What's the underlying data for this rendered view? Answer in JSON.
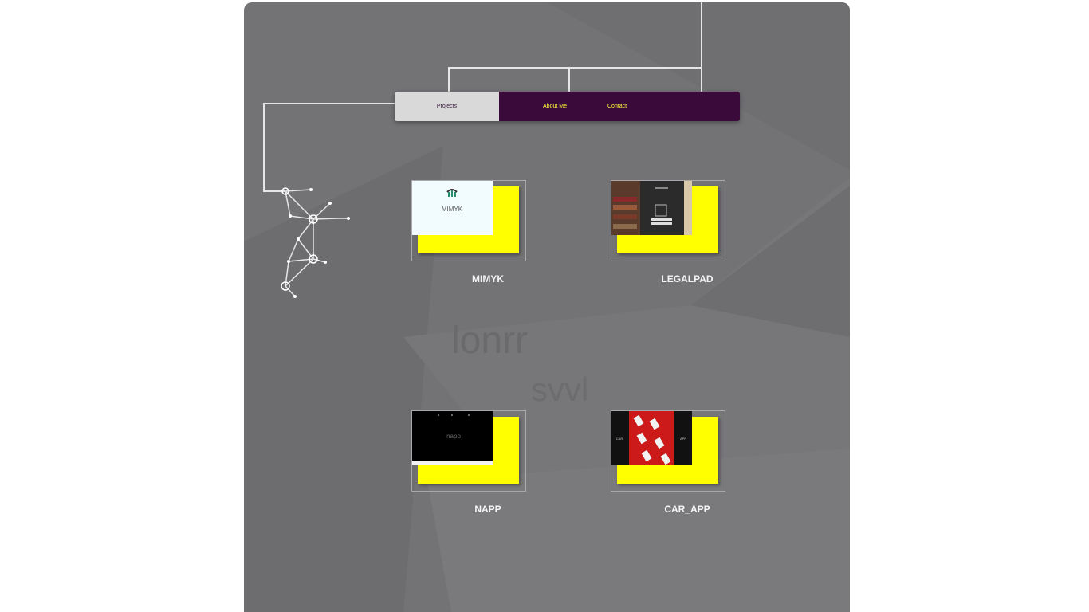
{
  "nav": {
    "projects_label": "Projects",
    "about_label": "About Me",
    "contact_label": "Contact"
  },
  "projects": [
    {
      "title": "MIMYK",
      "thumb_text": "MIMYK"
    },
    {
      "title": "LEGALPAD"
    },
    {
      "title": "NAPP",
      "thumb_text": "napp"
    },
    {
      "title": "CAR_APP",
      "thumb_left_text": "CAR",
      "thumb_right_text": "APP"
    }
  ],
  "colors": {
    "panel_bg": "#737376",
    "nav_active_bg": "#d9d9d9",
    "nav_bg": "#3a0a3a",
    "nav_text": "#ffff33",
    "card_accent": "#ffff00"
  }
}
